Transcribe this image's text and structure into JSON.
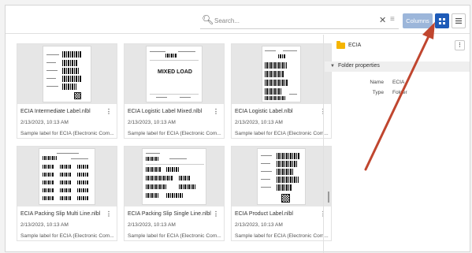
{
  "toolbar": {
    "search_placeholder": "Search...",
    "columns_label": "Columns",
    "clear_glyph": "✕",
    "filter_glyph": "≡"
  },
  "cards": [
    {
      "name": "ECIA Intermediate Label.nlbl",
      "date": "2/13/2023, 10:13 AM",
      "desc": "Sample label for ECIA (Electronic Com..."
    },
    {
      "name": "ECIA Logistic Label Mixed.nlbl",
      "date": "2/13/2023, 10:13 AM",
      "desc": "Sample label for ECIA (Electronic Com...",
      "preview_text": "MIXED LOAD"
    },
    {
      "name": "ECIA Logistic Label.nlbl",
      "date": "2/13/2023, 10:13 AM",
      "desc": "Sample label for ECIA (Electronic Com..."
    },
    {
      "name": "ECIA Packing Slip Multi Line.nlbl",
      "date": "2/13/2023, 10:13 AM",
      "desc": "Sample label for ECIA (Electronic Com..."
    },
    {
      "name": "ECIA Packing Slip Single Line.nlbl",
      "date": "2/13/2023, 10:13 AM",
      "desc": "Sample label for ECIA (Electronic Com..."
    },
    {
      "name": "ECIA Product Label.nlbl",
      "date": "2/13/2023, 10:13 AM",
      "desc": "Sample label for ECIA (Electronic Com..."
    }
  ],
  "panel": {
    "title": "ECIA",
    "section": "Folder properties",
    "props": [
      {
        "key": "Name",
        "value": "ECIA"
      },
      {
        "key": "Type",
        "value": "Folder"
      }
    ]
  },
  "colors": {
    "accent": "#1e5bb8",
    "columns_bg": "#9cb6da",
    "folder": "#f5b400",
    "annotation_arrow": "#c0462f"
  }
}
